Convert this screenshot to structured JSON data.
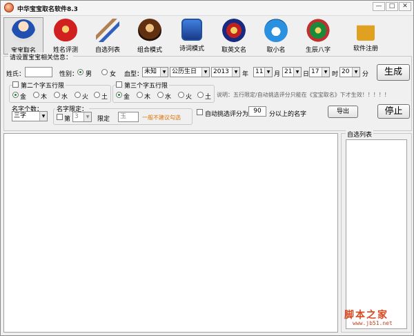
{
  "window": {
    "title": "中华宝宝取名软件8.3",
    "minimize": "—",
    "maximize": "□",
    "close": "✕"
  },
  "toolbar": [
    {
      "label": "宝宝取名",
      "icon": "baby-icon"
    },
    {
      "label": "姓名评测",
      "icon": "name-test-icon"
    },
    {
      "label": "自选列表",
      "icon": "brush-list-icon"
    },
    {
      "label": "组合模式",
      "icon": "combination-icon"
    },
    {
      "label": "诗词模式",
      "icon": "poetry-book-icon"
    },
    {
      "label": "取英文名",
      "icon": "english-name-icon"
    },
    {
      "label": "取小名",
      "icon": "nickname-icon"
    },
    {
      "label": "生辰八字",
      "icon": "bagua-icon"
    },
    {
      "label": "软件注册",
      "icon": "lock-icon"
    }
  ],
  "settings": {
    "legend": "请设置宝宝相关信息：",
    "surname_label": "姓氏：",
    "surname_value": "",
    "gender_label": "性别：",
    "male": "男",
    "female": "女",
    "blood_label": "血型：",
    "blood_value": "未知",
    "calendar_value": "公历生日",
    "year_value": "2013",
    "year_unit": "年",
    "month_value": "11",
    "month_unit": "月",
    "day_value": "21",
    "day_unit": "日",
    "hour_value": "17",
    "hour_unit": "时",
    "minute_value": "20",
    "minute_unit": "分",
    "generate": "生成",
    "second_char_label": "第二个字五行限",
    "third_char_label": "第三个字五行限",
    "elements": [
      "金",
      "木",
      "水",
      "火",
      "土"
    ],
    "note": "说明：五行限定/自动挑选评分只能在《宝宝取名》下才生效！！！！！",
    "name_count_label": "名字个数：",
    "name_count_value": "三字",
    "name_limit_label": "名字限定：",
    "position_label": "第",
    "position_value": "3",
    "limit_label": "限定",
    "limit_value": "玉",
    "limit_warning": "一般不建议勾选",
    "auto_pick_label": "自动挑选评分为：",
    "auto_pick_value": "90",
    "auto_pick_suffix": "分以上的名字",
    "export": "导出",
    "stop": "停止"
  },
  "self_list": {
    "legend": "自选列表"
  },
  "watermark": {
    "text": "脚本之家",
    "url": "www.jb51.net"
  }
}
